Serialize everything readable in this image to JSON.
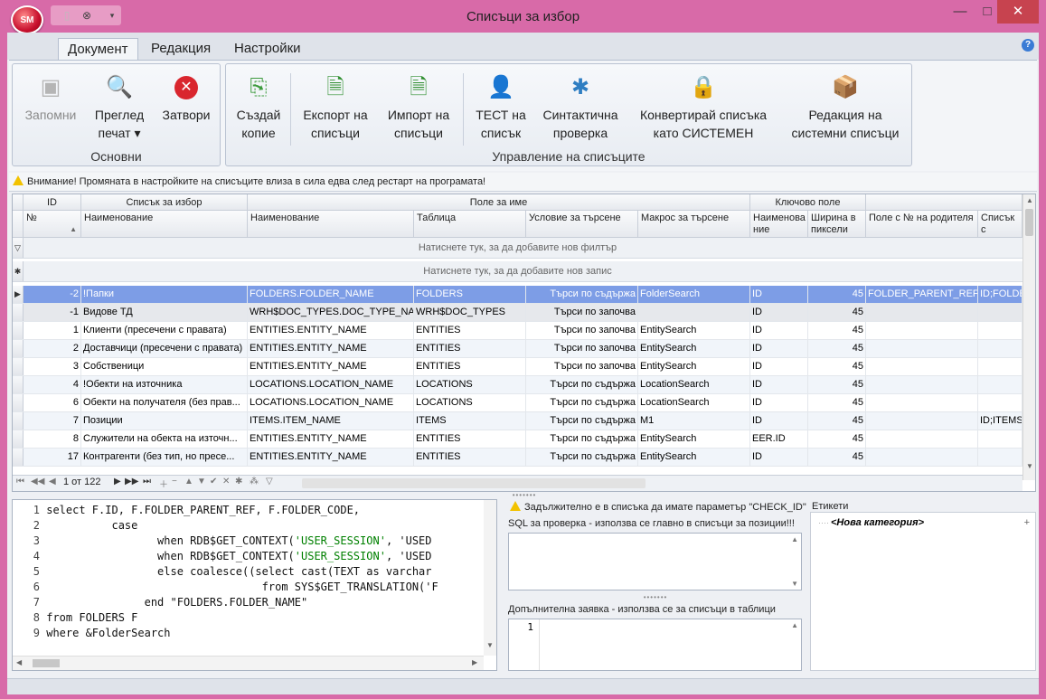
{
  "app": {
    "orb_label": "SM",
    "window_title": "Списъци за избор"
  },
  "ribbon": {
    "tabs": [
      "Документ",
      "Редакция",
      "Настройки"
    ],
    "groups": {
      "basic": {
        "label": "Основни",
        "buttons": {
          "save": "Запомни",
          "preview_1": "Преглед",
          "preview_2": "печат ▾",
          "close": "Затвори"
        }
      },
      "manage": {
        "label": "Управление на списъците",
        "buttons": {
          "copy_1": "Създай",
          "copy_2": "копие",
          "export_1": "Експорт на",
          "export_2": "списъци",
          "import_1": "Импорт на",
          "import_2": "списъци",
          "test_1": "ТЕСТ на",
          "test_2": "списък",
          "syntax_1": "Синтактична",
          "syntax_2": "проверка",
          "convert_1": "Конвертирай списъка",
          "convert_2": "като СИСТЕМЕН",
          "edit_sys_1": "Редакция на",
          "edit_sys_2": "системни списъци"
        }
      }
    }
  },
  "info_bar": {
    "text": "Внимание! Промяната в настройките на списъците влиза в сила едва след рестарт на програмата!"
  },
  "grid": {
    "bands": {
      "id": "ID",
      "list": "Списък за избор",
      "name_field": "Поле за име",
      "key_field": "Ключово поле"
    },
    "columns": {
      "no": "№",
      "name": "Наименование",
      "field_name": "Наименование",
      "table": "Таблица",
      "search_cond": "Условие за търсене",
      "search_macro": "Макрос за търсене",
      "key_name": "Наименова ние",
      "width": "Ширина в пиксели",
      "parent_field": "Поле с № на родителя",
      "fields_list": "Списък с полета"
    },
    "filter_prompt": "Натиснете тук, за да добавите нов филтър",
    "new_record_prompt": "Натиснете тук, за да добавите нов запис",
    "rows": [
      {
        "id": "-2",
        "name": "!Папки",
        "field": "FOLDERS.FOLDER_NAME",
        "table": "FOLDERS",
        "cond": "Търси по съдържа",
        "macro": "FolderSearch",
        "key": "ID",
        "width": "45",
        "parent": "FOLDER_PARENT_REF",
        "fields": "ID;FOLDE"
      },
      {
        "id": "-1",
        "name": "Видове ТД",
        "field": "WRH$DOC_TYPES.DOC_TYPE_NAME",
        "table": "WRH$DOC_TYPES",
        "cond": "Търси по започва",
        "macro": "",
        "key": "ID",
        "width": "45",
        "parent": "",
        "fields": ""
      },
      {
        "id": "1",
        "name": "Клиенти (пресечени с правата)",
        "field": "ENTITIES.ENTITY_NAME",
        "table": "ENTITIES",
        "cond": "Търси по започва",
        "macro": "EntitySearch",
        "key": "ID",
        "width": "45",
        "parent": "",
        "fields": ""
      },
      {
        "id": "2",
        "name": "Доставчици (пресечени с правата)",
        "field": "ENTITIES.ENTITY_NAME",
        "table": "ENTITIES",
        "cond": "Търси по започва",
        "macro": "EntitySearch",
        "key": "ID",
        "width": "45",
        "parent": "",
        "fields": ""
      },
      {
        "id": "3",
        "name": "Собственици",
        "field": "ENTITIES.ENTITY_NAME",
        "table": "ENTITIES",
        "cond": "Търси по започва",
        "macro": "EntitySearch",
        "key": "ID",
        "width": "45",
        "parent": "",
        "fields": ""
      },
      {
        "id": "4",
        "name": "!Обекти на източника",
        "field": "LOCATIONS.LOCATION_NAME",
        "table": "LOCATIONS",
        "cond": "Търси по съдържа",
        "macro": "LocationSearch",
        "key": "ID",
        "width": "45",
        "parent": "",
        "fields": ""
      },
      {
        "id": "6",
        "name": "Обекти на получателя (без прав...",
        "field": "LOCATIONS.LOCATION_NAME",
        "table": "LOCATIONS",
        "cond": "Търси по съдържа",
        "macro": "LocationSearch",
        "key": "ID",
        "width": "45",
        "parent": "",
        "fields": ""
      },
      {
        "id": "7",
        "name": "Позиции",
        "field": "ITEMS.ITEM_NAME",
        "table": "ITEMS",
        "cond": "Търси по съдържа",
        "macro": "M1",
        "key": "ID",
        "width": "45",
        "parent": "",
        "fields": "ID;ITEMS"
      },
      {
        "id": "8",
        "name": "Служители на обекта на източн...",
        "field": "ENTITIES.ENTITY_NAME",
        "table": "ENTITIES",
        "cond": "Търси по съдържа",
        "macro": "EntitySearch",
        "key": "EER.ID",
        "width": "45",
        "parent": "",
        "fields": ""
      },
      {
        "id": "17",
        "name": "Контрагенти (без тип, но пресе...",
        "field": "ENTITIES.ENTITY_NAME",
        "table": "ENTITIES",
        "cond": "Търси по съдържа",
        "macro": "EntitySearch",
        "key": "ID",
        "width": "45",
        "parent": "",
        "fields": ""
      }
    ],
    "pager": "1 от 122"
  },
  "editor": {
    "lines": [
      {
        "n": "1",
        "pre": "select F.ID, F.FOLDER_PARENT_REF, F.FOLDER_CODE,",
        "str": "",
        "post": ""
      },
      {
        "n": "2",
        "pre": "          case",
        "str": "",
        "post": ""
      },
      {
        "n": "3",
        "pre": "                 when RDB$GET_CONTEXT(",
        "str": "'USER_SESSION'",
        "post": ", 'USED"
      },
      {
        "n": "4",
        "pre": "                 when RDB$GET_CONTEXT(",
        "str": "'USER_SESSION'",
        "post": ", 'USED"
      },
      {
        "n": "5",
        "pre": "                 else coalesce((select cast(TEXT as varchar",
        "str": "",
        "post": ""
      },
      {
        "n": "6",
        "pre": "                                 from SYS$GET_TRANSLATION('F",
        "str": "",
        "post": ""
      },
      {
        "n": "7",
        "pre": "               end \"FOLDERS.FOLDER_NAME\"",
        "str": "",
        "post": ""
      },
      {
        "n": "8",
        "pre": "from FOLDERS F",
        "str": "",
        "post": ""
      },
      {
        "n": "9",
        "pre": "where &FolderSearch",
        "str": "",
        "post": ""
      }
    ]
  },
  "check_panel": {
    "warning": "Задължително е в списъка да имате параметър \"CHECK_ID\"",
    "sql_label": "SQL за проверка - използва се главно в списъци за позиции!!!",
    "extra_label": "Допълнителна заявка - използва се за списъци в таблици",
    "extra_line": "1"
  },
  "tags_panel": {
    "label": "Етикети",
    "new_category": "<Нова категория>"
  }
}
